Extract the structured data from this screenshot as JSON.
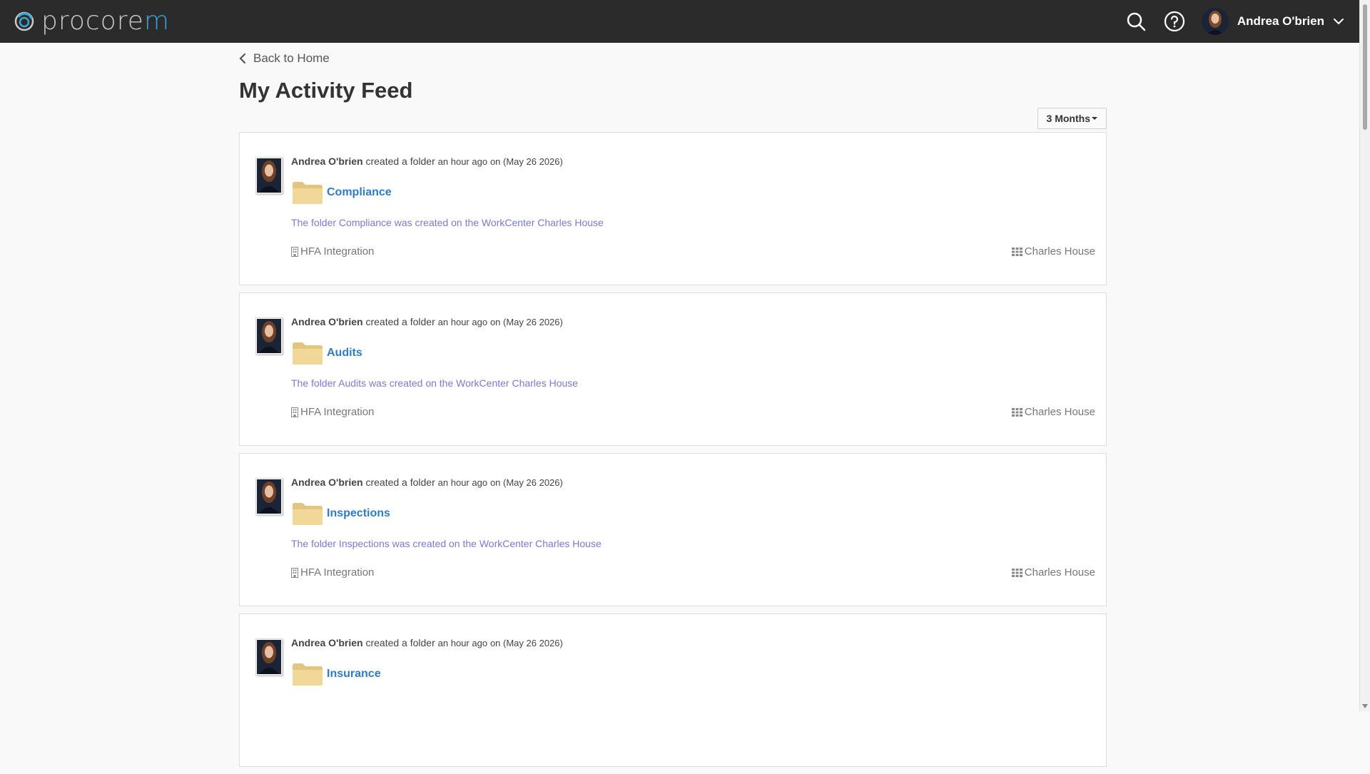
{
  "header": {
    "logo_prefix": "procore",
    "logo_suffix": "m",
    "user_name": "Andrea O'brien",
    "brand_color": "#38a6d8",
    "bar_color": "#2b2b2b"
  },
  "nav": {
    "back_label": "Back to Home"
  },
  "page": {
    "title": "My Activity Feed"
  },
  "filter": {
    "range_label": "3 Months"
  },
  "feed": [
    {
      "actor": "Andrea O'brien",
      "action": "created a folder",
      "time_ago": "an hour ago",
      "date_text": "on (May 26 2026)",
      "folder": "Compliance",
      "description": "The folder Compliance was created on the WorkCenter Charles House",
      "integration": "HFA Integration",
      "workcenter": "Charles House"
    },
    {
      "actor": "Andrea O'brien",
      "action": "created a folder",
      "time_ago": "an hour ago",
      "date_text": "on (May 26 2026)",
      "folder": "Audits",
      "description": "The folder Audits was created on the WorkCenter Charles House",
      "integration": "HFA Integration",
      "workcenter": "Charles House"
    },
    {
      "actor": "Andrea O'brien",
      "action": "created a folder",
      "time_ago": "an hour ago",
      "date_text": "on (May 26 2026)",
      "folder": "Inspections",
      "description": "The folder Inspections was created on the WorkCenter Charles House",
      "integration": "HFA Integration",
      "workcenter": "Charles House"
    },
    {
      "actor": "Andrea O'brien",
      "action": "created a folder",
      "time_ago": "an hour ago",
      "date_text": "on (May 26 2026)",
      "folder": "Insurance"
    }
  ]
}
